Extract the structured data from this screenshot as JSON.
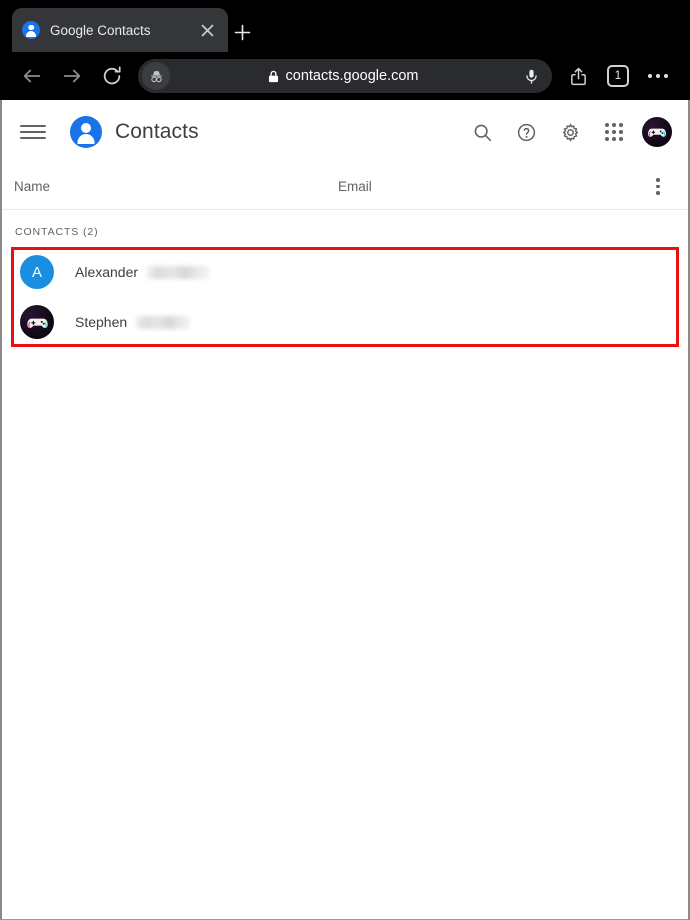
{
  "browser": {
    "tab": {
      "title": "Google Contacts",
      "favicon": "google-contacts-favicon",
      "close_label": "×"
    },
    "new_tab_label": "+",
    "toolbar": {
      "back": "back-arrow",
      "forward": "forward-arrow",
      "reload": "reload-arrow",
      "incognito": "incognito-hat-glasses",
      "lock": "lock-icon",
      "url": "contacts.google.com",
      "mic": "microphone-icon",
      "share": "share-icon",
      "tab_count": "1",
      "menu": "three-dot-menu"
    }
  },
  "app": {
    "menu_icon": "hamburger-menu",
    "logo": "contacts-person-logo",
    "title": "Contacts",
    "actions": [
      {
        "name": "search",
        "icon": "search-icon"
      },
      {
        "name": "help",
        "icon": "help-question-icon"
      },
      {
        "name": "settings",
        "icon": "gear-icon"
      },
      {
        "name": "apps",
        "icon": "apps-grid-icon"
      }
    ],
    "account_avatar": "gamepad-avatar"
  },
  "table": {
    "columns": {
      "name": "Name",
      "email": "Email"
    },
    "more_menu": "three-dot-menu",
    "section_label": "CONTACTS (2)",
    "rows": [
      {
        "avatar_type": "letter",
        "avatar_letter": "A",
        "avatar_color": "#1a8ee0",
        "first_name": "Alexander",
        "last_name_redacted": true,
        "email": ""
      },
      {
        "avatar_type": "image",
        "avatar_image": "gamepad-avatar",
        "first_name": "Stephen",
        "last_name_redacted": true,
        "email": ""
      }
    ]
  },
  "annotation": {
    "type": "rectangle-highlight",
    "color": "#e81010",
    "target": "contacts-list"
  }
}
